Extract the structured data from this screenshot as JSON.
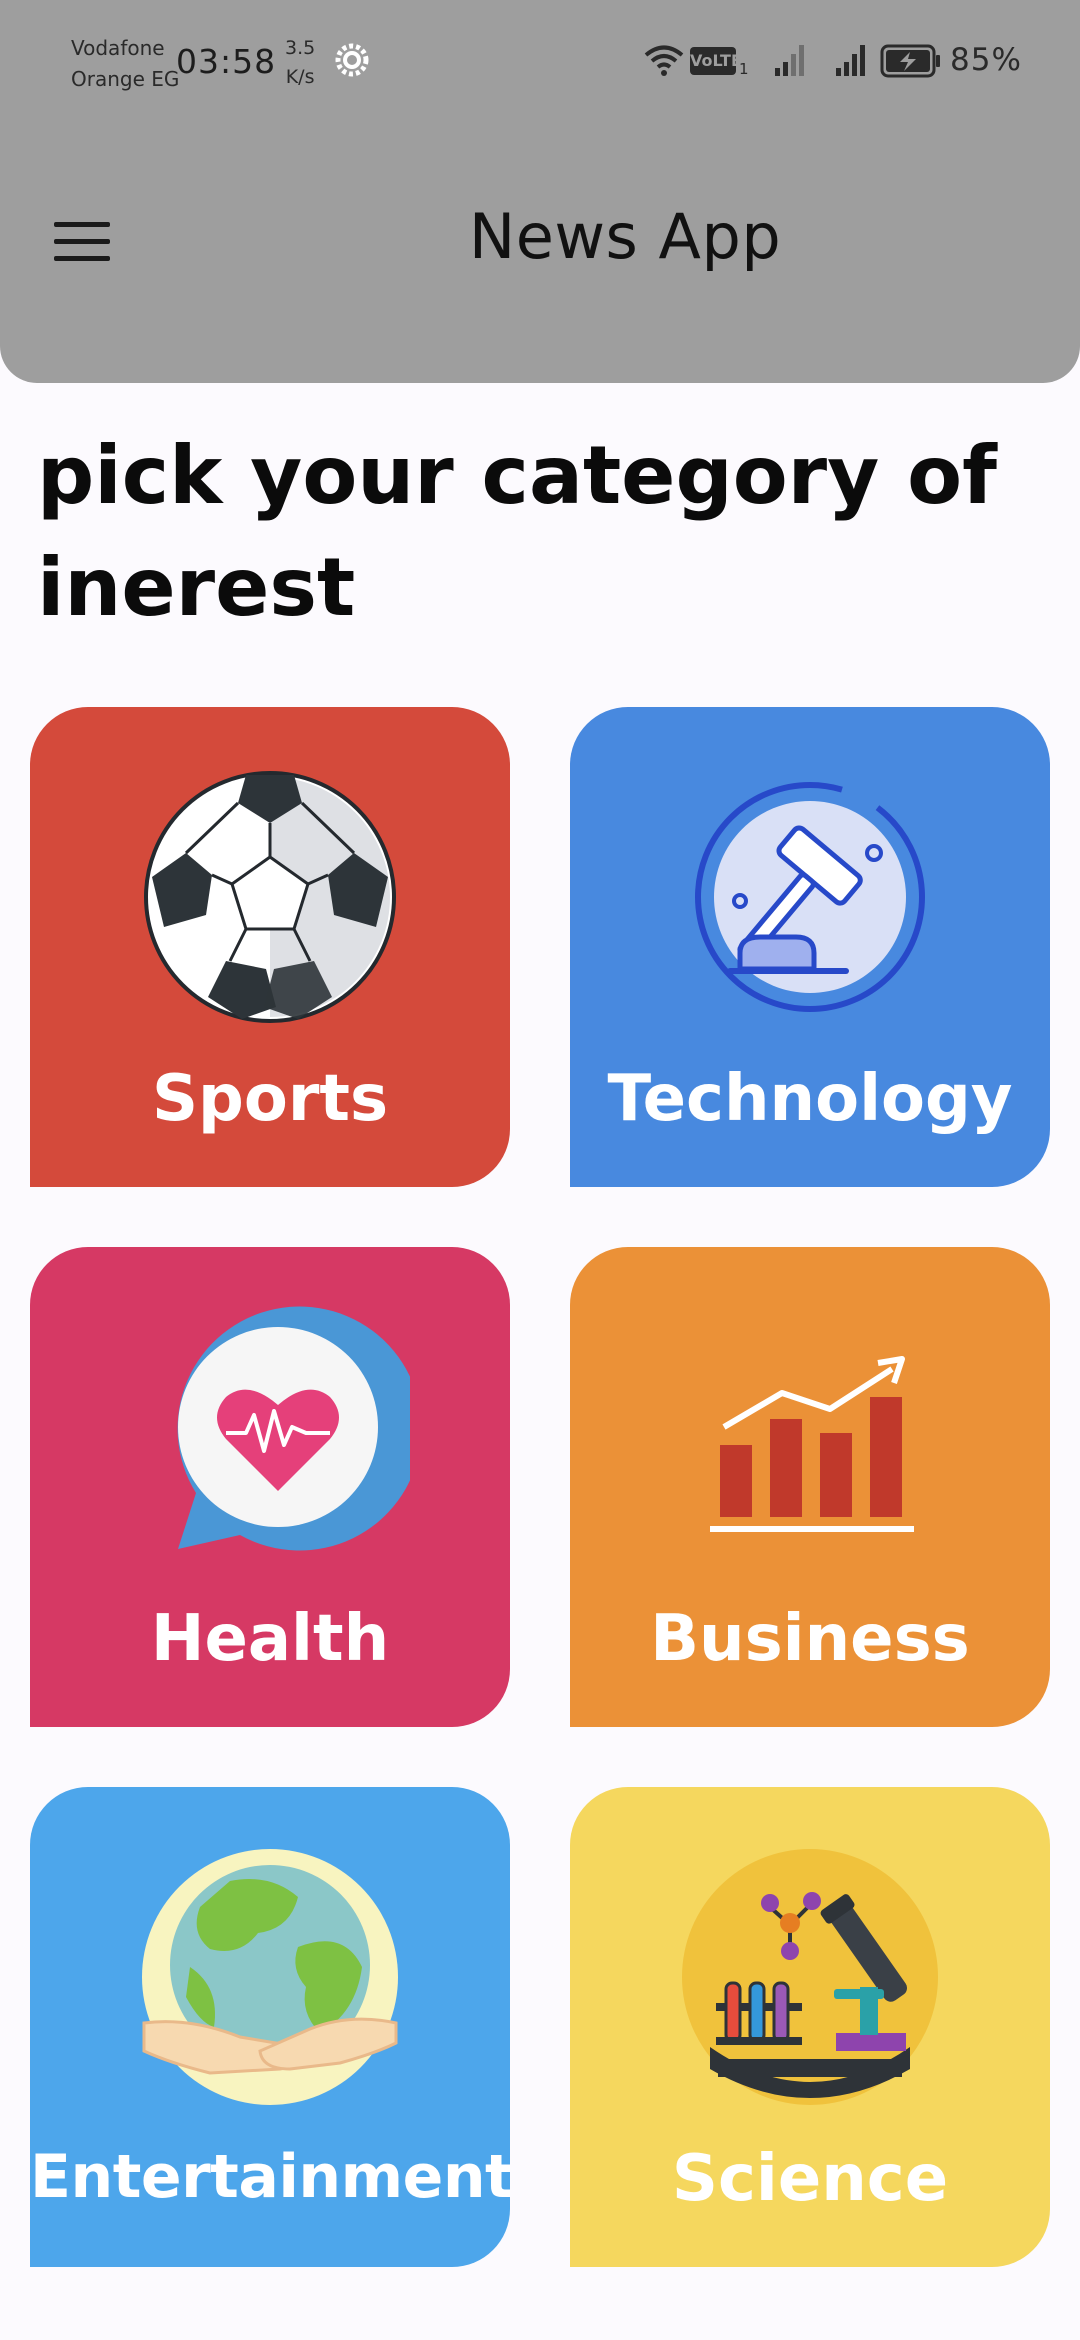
{
  "status_bar": {
    "carrier_line1": "Vodafone",
    "carrier_line2": "Orange EG",
    "time": "03:58",
    "speed_value": "3.5",
    "speed_unit": "K/s",
    "volte": "VoLTE",
    "sim_number": "1",
    "battery_percent": "85%"
  },
  "app_bar": {
    "title": "News App",
    "menu_icon": "hamburger-menu-icon",
    "background_color": "#9E9E9E"
  },
  "page": {
    "heading": "pick your category of inerest",
    "background_color": "#FCFAFE"
  },
  "categories": [
    {
      "label": "Sports",
      "color": "#D44A3B",
      "icon": "soccer-ball-icon"
    },
    {
      "label": "Technology",
      "color": "#4889DF",
      "icon": "gavel-icon"
    },
    {
      "label": "Health",
      "color": "#D63964",
      "icon": "heart-chat-icon"
    },
    {
      "label": "Business",
      "color": "#EB9137",
      "icon": "bar-chart-icon"
    },
    {
      "label": "Entertainment",
      "color": "#4DA6EB",
      "icon": "globe-hands-icon"
    },
    {
      "label": "Science",
      "color": "#F5D75E",
      "icon": "microscope-lab-icon"
    }
  ]
}
